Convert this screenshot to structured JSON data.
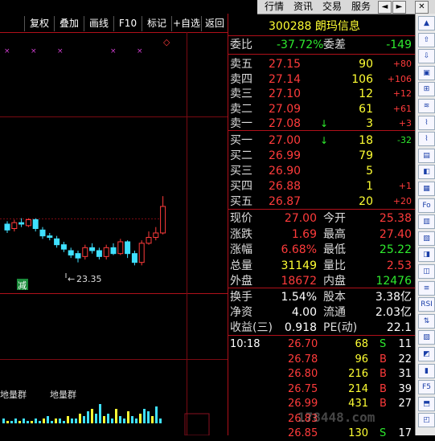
{
  "top_tabs": [
    "行情",
    "资讯",
    "交易",
    "服务"
  ],
  "top_buttons": [
    "◄",
    "►",
    "✕"
  ],
  "chart_toolbar": [
    "复权",
    "叠加",
    "画线",
    "F10",
    "标记",
    "+自选",
    "返回"
  ],
  "chart": {
    "low_label": "23.35",
    "reduce_mark": "减",
    "vol_label1": "地量群",
    "vol_label2": "地量群",
    "candles": [
      {
        "o": 27.06,
        "c": 27.02,
        "h": 27.08,
        "l": 27.0
      },
      {
        "o": 27.03,
        "c": 27.07,
        "h": 27.09,
        "l": 27.01
      },
      {
        "o": 27.07,
        "c": 27.06,
        "h": 27.1,
        "l": 27.04
      },
      {
        "o": 27.05,
        "c": 27.09,
        "h": 27.1,
        "l": 27.04
      },
      {
        "o": 27.09,
        "c": 27.03,
        "h": 27.1,
        "l": 27.01
      },
      {
        "o": 27.02,
        "c": 26.98,
        "h": 27.04,
        "l": 26.96
      },
      {
        "o": 26.98,
        "c": 26.97,
        "h": 27.0,
        "l": 26.95
      },
      {
        "o": 26.96,
        "c": 26.92,
        "h": 26.98,
        "l": 26.9
      },
      {
        "o": 26.92,
        "c": 26.89,
        "h": 26.94,
        "l": 26.87
      },
      {
        "o": 26.88,
        "c": 26.85,
        "h": 26.9,
        "l": 26.83
      },
      {
        "o": 26.86,
        "c": 26.83,
        "h": 26.88,
        "l": 26.8
      },
      {
        "o": 26.84,
        "c": 26.9,
        "h": 26.92,
        "l": 26.82
      },
      {
        "o": 26.9,
        "c": 26.88,
        "h": 26.93,
        "l": 26.86
      },
      {
        "o": 26.88,
        "c": 26.84,
        "h": 26.9,
        "l": 26.82
      },
      {
        "o": 26.84,
        "c": 26.9,
        "h": 26.92,
        "l": 26.82
      },
      {
        "o": 26.9,
        "c": 26.86,
        "h": 26.93,
        "l": 26.85
      },
      {
        "o": 26.86,
        "c": 26.94,
        "h": 26.96,
        "l": 26.85
      },
      {
        "o": 26.94,
        "c": 26.86,
        "h": 26.95,
        "l": 26.83
      },
      {
        "o": 26.86,
        "c": 26.8,
        "h": 26.88,
        "l": 26.78
      },
      {
        "o": 26.8,
        "c": 26.93,
        "h": 26.95,
        "l": 26.78
      },
      {
        "o": 26.93,
        "c": 26.97,
        "h": 27.01,
        "l": 26.92
      },
      {
        "o": 26.97,
        "c": 27.0,
        "h": 27.04,
        "l": 26.95
      },
      {
        "o": 27.0,
        "c": 27.18,
        "h": 27.25,
        "l": 26.99
      }
    ],
    "volumes": [
      2,
      1,
      1,
      2,
      1,
      2,
      1,
      1,
      2,
      1,
      2,
      3,
      1,
      2,
      2,
      1,
      3,
      2,
      2,
      4,
      3,
      5,
      6,
      4,
      8,
      3,
      4,
      2,
      6,
      3,
      2,
      5,
      3,
      2,
      4,
      6,
      5,
      3,
      7,
      2
    ]
  },
  "quote": {
    "code_name": "300288 朗玛信息",
    "committee_ratio_label": "委比",
    "committee_ratio": "-37.72%",
    "committee_diff_label": "委差",
    "committee_diff": "-149",
    "asks": [
      {
        "label": "卖五",
        "price": "27.15",
        "vol": "90",
        "chg": "+80"
      },
      {
        "label": "卖四",
        "price": "27.14",
        "vol": "106",
        "chg": "+106"
      },
      {
        "label": "卖三",
        "price": "27.10",
        "vol": "12",
        "chg": "+12"
      },
      {
        "label": "卖二",
        "price": "27.09",
        "vol": "61",
        "chg": "+61"
      },
      {
        "label": "卖一",
        "price": "27.08",
        "vol": "3",
        "chg": "+3",
        "arrow": "↓"
      }
    ],
    "bids": [
      {
        "label": "买一",
        "price": "27.00",
        "vol": "18",
        "chg": "-32",
        "arrow": "↓"
      },
      {
        "label": "买二",
        "price": "26.99",
        "vol": "79",
        "chg": ""
      },
      {
        "label": "买三",
        "price": "26.90",
        "vol": "5",
        "chg": ""
      },
      {
        "label": "买四",
        "price": "26.88",
        "vol": "1",
        "chg": "+1"
      },
      {
        "label": "买五",
        "price": "26.87",
        "vol": "20",
        "chg": "+20"
      }
    ],
    "stats": [
      {
        "l1": "现价",
        "v1": "27.00",
        "l2": "今开",
        "v2": "25.38",
        "c1": "red",
        "c2": "red"
      },
      {
        "l1": "涨跌",
        "v1": "1.69",
        "l2": "最高",
        "v2": "27.40",
        "c1": "red",
        "c2": "red"
      },
      {
        "l1": "涨幅",
        "v1": "6.68%",
        "l2": "最低",
        "v2": "25.22",
        "c1": "red",
        "c2": "green"
      },
      {
        "l1": "总量",
        "v1": "31149",
        "l2": "量比",
        "v2": "2.53",
        "c1": "yellow",
        "c2": "red"
      },
      {
        "l1": "外盘",
        "v1": "18672",
        "l2": "内盘",
        "v2": "12476",
        "c1": "red",
        "c2": "green"
      }
    ],
    "fund": [
      {
        "l1": "换手",
        "v1": "1.54%",
        "l2": "股本",
        "v2": "3.38亿"
      },
      {
        "l1": "净资",
        "v1": "4.00",
        "l2": "流通",
        "v2": "2.03亿"
      },
      {
        "l1": "收益(三)",
        "v1": "0.918",
        "l2": "PE(动)",
        "v2": "22.1"
      }
    ],
    "ticks": [
      {
        "time": "10:18",
        "price": "26.70",
        "vol": "68",
        "side": "S",
        "n": "11"
      },
      {
        "time": "",
        "price": "26.78",
        "vol": "96",
        "side": "B",
        "n": "22"
      },
      {
        "time": "",
        "price": "26.80",
        "vol": "216",
        "side": "B",
        "n": "31"
      },
      {
        "time": "",
        "price": "26.75",
        "vol": "214",
        "side": "B",
        "n": "39"
      },
      {
        "time": "",
        "price": "26.99",
        "vol": "431",
        "side": "B",
        "n": "27"
      },
      {
        "time": "",
        "price": "26.83",
        "vol": "",
        "side": "",
        "n": ""
      },
      {
        "time": "",
        "price": "26.85",
        "vol": "130",
        "side": "S",
        "n": "17"
      }
    ]
  },
  "watermark": "178448.com",
  "right_icons": [
    "▲",
    "⇧",
    "⇩",
    "▣",
    "⊞",
    "≋",
    "⌇",
    "⌇",
    "▤",
    "◧",
    "▦",
    "Fo",
    "▥",
    "▧",
    "◨",
    "◫",
    "≡",
    "RSI",
    "⇅",
    "▨",
    "◩",
    "▮",
    "F5",
    "⬒",
    "◰"
  ]
}
